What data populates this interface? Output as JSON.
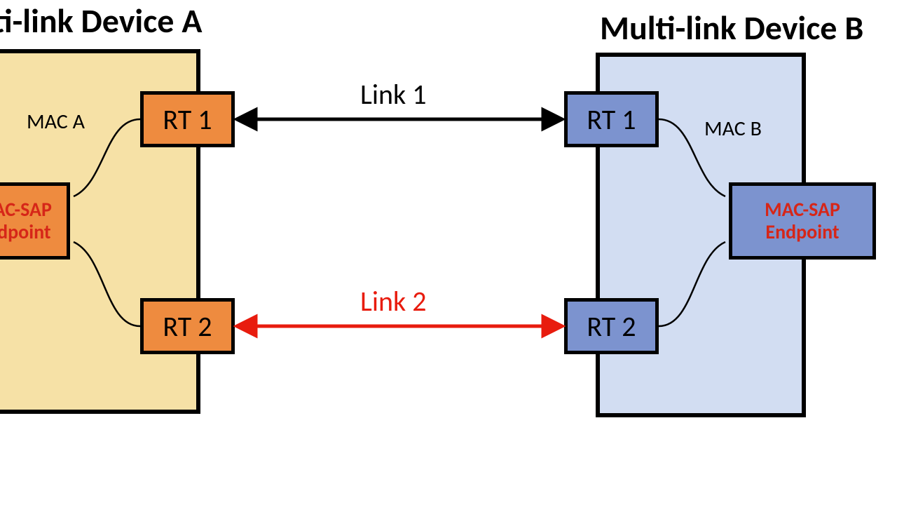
{
  "titles": {
    "a": "Multi-link Device A",
    "b": "Multi-link Device B"
  },
  "deviceA": {
    "mac_label": "MAC A",
    "rt1": "RT 1",
    "rt2": "RT 2",
    "sap1": "MAC-SAP",
    "sap2": "Endpoint"
  },
  "deviceB": {
    "mac_label": "MAC B",
    "rt1": "RT 1",
    "rt2": "RT 2",
    "sap1": "MAC-SAP",
    "sap2": "Endpoint"
  },
  "links": {
    "l1": "Link 1",
    "l2": "Link 2"
  }
}
